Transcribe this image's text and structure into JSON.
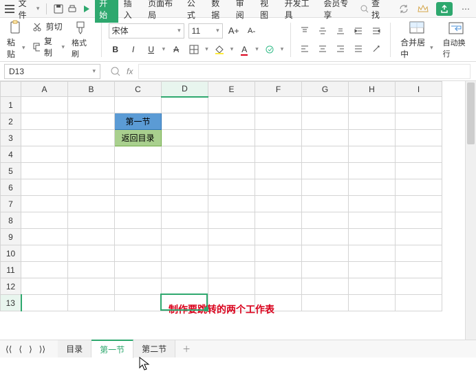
{
  "menubar": {
    "file": "文件",
    "tabs": [
      "开始",
      "插入",
      "页面布局",
      "公式",
      "数据",
      "审阅",
      "视图",
      "开发工具",
      "会员专享"
    ],
    "active_tab": 0,
    "search_placeholder": "查找"
  },
  "ribbon": {
    "clipboard": {
      "cut": "剪切",
      "copy": "复制",
      "paste": "粘贴",
      "format_painter": "格式刷"
    },
    "font": {
      "name": "宋体",
      "size": "11"
    },
    "align": {
      "merge": "合并居中",
      "wrap": "自动换行"
    }
  },
  "namebox": {
    "ref": "D13"
  },
  "formula_bar": {
    "value": ""
  },
  "sheet": {
    "columns": [
      "A",
      "B",
      "C",
      "D",
      "E",
      "F",
      "G",
      "H",
      "I"
    ],
    "active_col": 3,
    "rows": 13,
    "active_row": 13,
    "cells": {
      "C2": {
        "text": "第一节",
        "style": "blue"
      },
      "C3": {
        "text": "返回目录",
        "style": "green"
      }
    }
  },
  "annotation": "制作要跳转的两个工作表",
  "tabs": {
    "items": [
      "目录",
      "第一节",
      "第二节"
    ],
    "active": 1
  }
}
